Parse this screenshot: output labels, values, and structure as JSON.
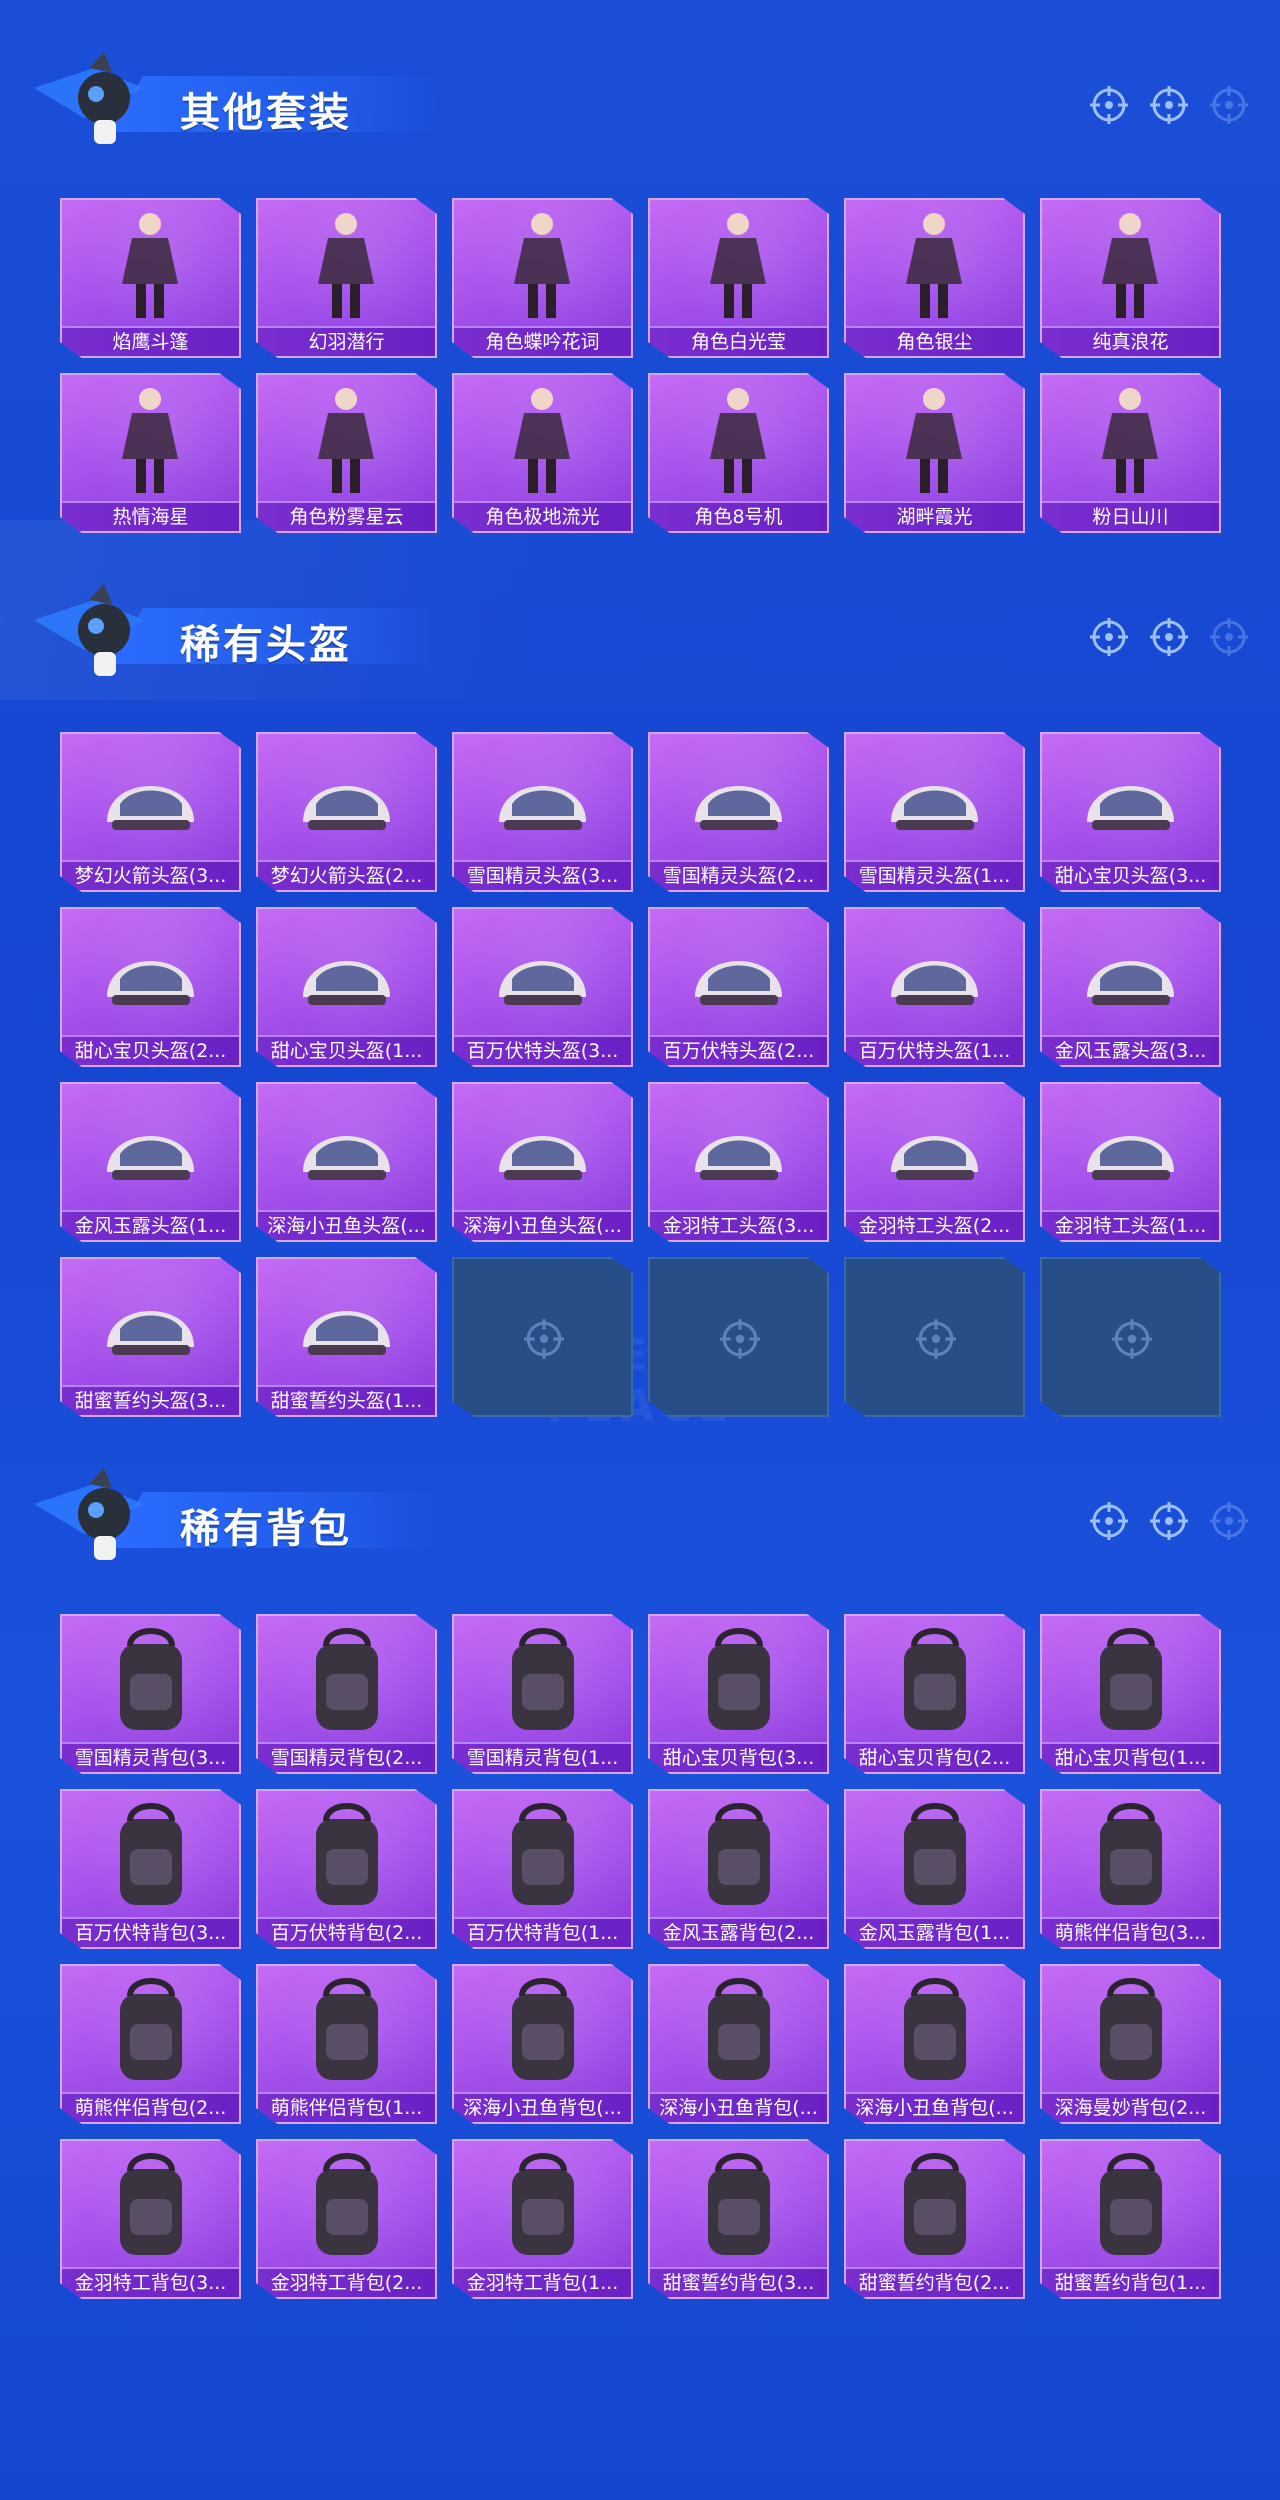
{
  "watermark": "GAME FOR PEACE",
  "colors": {
    "background": "#1a4fd6",
    "card": "#b55cf0",
    "label_bar": "#7a2ed0",
    "empty_slot": "#284e88"
  },
  "sections": [
    {
      "title": "其他套装",
      "items": [
        {
          "label": "焰鹰斗篷",
          "icon": "outfit-icon"
        },
        {
          "label": "幻羽潜行",
          "icon": "outfit-icon"
        },
        {
          "label": "角色蝶吟花词",
          "icon": "outfit-icon"
        },
        {
          "label": "角色白光莹",
          "icon": "outfit-icon"
        },
        {
          "label": "角色银尘",
          "icon": "outfit-icon"
        },
        {
          "label": "纯真浪花",
          "icon": "outfit-icon"
        },
        {
          "label": "热情海星",
          "icon": "outfit-icon"
        },
        {
          "label": "角色粉雾星云",
          "icon": "outfit-icon"
        },
        {
          "label": "角色极地流光",
          "icon": "outfit-icon"
        },
        {
          "label": "角色8号机",
          "icon": "outfit-icon"
        },
        {
          "label": "湖畔霞光",
          "icon": "outfit-icon"
        },
        {
          "label": "粉日山川",
          "icon": "outfit-icon"
        }
      ]
    },
    {
      "title": "稀有头盔",
      "items": [
        {
          "label": "梦幻火箭头盔(3...",
          "icon": "helmet-icon"
        },
        {
          "label": "梦幻火箭头盔(2...",
          "icon": "helmet-icon"
        },
        {
          "label": "雪国精灵头盔(3...",
          "icon": "helmet-icon"
        },
        {
          "label": "雪国精灵头盔(2...",
          "icon": "helmet-icon"
        },
        {
          "label": "雪国精灵头盔(1...",
          "icon": "helmet-icon"
        },
        {
          "label": "甜心宝贝头盔(3...",
          "icon": "helmet-icon"
        },
        {
          "label": "甜心宝贝头盔(2...",
          "icon": "helmet-icon"
        },
        {
          "label": "甜心宝贝头盔(1...",
          "icon": "helmet-icon"
        },
        {
          "label": "百万伏特头盔(3...",
          "icon": "helmet-icon"
        },
        {
          "label": "百万伏特头盔(2...",
          "icon": "helmet-icon"
        },
        {
          "label": "百万伏特头盔(1...",
          "icon": "helmet-icon"
        },
        {
          "label": "金风玉露头盔(3...",
          "icon": "helmet-icon"
        },
        {
          "label": "金风玉露头盔(1...",
          "icon": "helmet-icon"
        },
        {
          "label": "深海小丑鱼头盔(...",
          "icon": "helmet-icon"
        },
        {
          "label": "深海小丑鱼头盔(...",
          "icon": "helmet-icon"
        },
        {
          "label": "金羽特工头盔(3...",
          "icon": "helmet-icon"
        },
        {
          "label": "金羽特工头盔(2...",
          "icon": "helmet-icon"
        },
        {
          "label": "金羽特工头盔(1...",
          "icon": "helmet-icon"
        },
        {
          "label": "甜蜜誓约头盔(3...",
          "icon": "helmet-icon"
        },
        {
          "label": "甜蜜誓约头盔(1...",
          "icon": "helmet-icon"
        },
        {
          "label": "",
          "icon": "crosshair-icon",
          "empty": true
        },
        {
          "label": "",
          "icon": "crosshair-icon",
          "empty": true
        },
        {
          "label": "",
          "icon": "crosshair-icon",
          "empty": true
        },
        {
          "label": "",
          "icon": "crosshair-icon",
          "empty": true
        }
      ]
    },
    {
      "title": "稀有背包",
      "items": [
        {
          "label": "雪国精灵背包(3...",
          "icon": "backpack-icon"
        },
        {
          "label": "雪国精灵背包(2...",
          "icon": "backpack-icon"
        },
        {
          "label": "雪国精灵背包(1...",
          "icon": "backpack-icon"
        },
        {
          "label": "甜心宝贝背包(3...",
          "icon": "backpack-icon"
        },
        {
          "label": "甜心宝贝背包(2...",
          "icon": "backpack-icon"
        },
        {
          "label": "甜心宝贝背包(1...",
          "icon": "backpack-icon"
        },
        {
          "label": "百万伏特背包(3...",
          "icon": "backpack-icon"
        },
        {
          "label": "百万伏特背包(2...",
          "icon": "backpack-icon"
        },
        {
          "label": "百万伏特背包(1...",
          "icon": "backpack-icon"
        },
        {
          "label": "金风玉露背包(2...",
          "icon": "backpack-icon"
        },
        {
          "label": "金风玉露背包(1...",
          "icon": "backpack-icon"
        },
        {
          "label": "萌熊伴侣背包(3...",
          "icon": "backpack-icon"
        },
        {
          "label": "萌熊伴侣背包(2...",
          "icon": "backpack-icon"
        },
        {
          "label": "萌熊伴侣背包(1...",
          "icon": "backpack-icon"
        },
        {
          "label": "深海小丑鱼背包(...",
          "icon": "backpack-icon"
        },
        {
          "label": "深海小丑鱼背包(...",
          "icon": "backpack-icon"
        },
        {
          "label": "深海小丑鱼背包(...",
          "icon": "backpack-icon"
        },
        {
          "label": "深海曼妙背包(2...",
          "icon": "backpack-icon"
        },
        {
          "label": "金羽特工背包(3...",
          "icon": "backpack-icon"
        },
        {
          "label": "金羽特工背包(2...",
          "icon": "backpack-icon"
        },
        {
          "label": "金羽特工背包(1...",
          "icon": "backpack-icon"
        },
        {
          "label": "甜蜜誓约背包(3...",
          "icon": "backpack-icon"
        },
        {
          "label": "甜蜜誓约背包(2...",
          "icon": "backpack-icon"
        },
        {
          "label": "甜蜜誓约背包(1...",
          "icon": "backpack-icon"
        }
      ]
    }
  ]
}
